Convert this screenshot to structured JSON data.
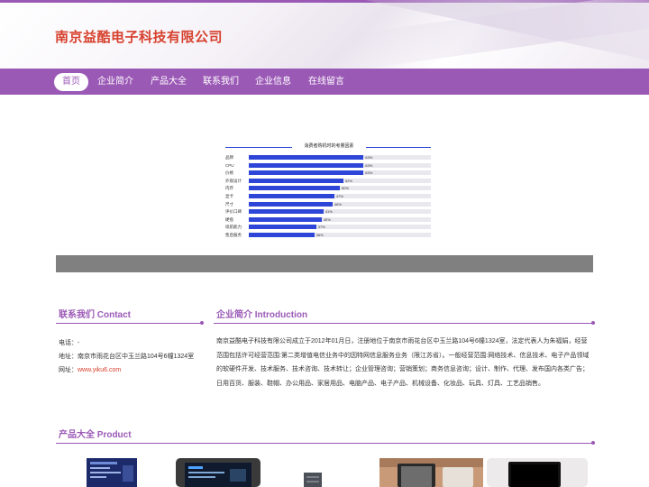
{
  "header": {
    "title": "南京益酷电子科技有限公司"
  },
  "nav": {
    "items": [
      "首页",
      "企业简介",
      "产品大全",
      "联系我们",
      "企业信息",
      "在线留言"
    ],
    "active_index": 0
  },
  "banner_chart": {
    "title": "消费者购机时的考量因素",
    "chart_data": {
      "type": "bar",
      "categories": [
        "品牌",
        "CPU",
        "价格",
        "外观设计",
        "内存",
        "显卡",
        "尺寸",
        "评价口碑",
        "硬盘",
        "续航能力",
        "售后服务"
      ],
      "values": [
        63,
        63,
        63,
        52,
        50,
        47,
        46,
        41,
        40,
        37,
        36
      ],
      "value_labels": [
        "63%",
        "63%",
        "63%",
        "52%",
        "50%",
        "47%",
        "46%",
        "41%",
        "40%",
        "37%",
        "36%"
      ],
      "xlim": [
        0,
        100
      ],
      "orientation": "horizontal",
      "bar_color": "#2d46d8"
    }
  },
  "contact": {
    "title": "联系我们 Contact",
    "phone_label": "电话：-",
    "address_label": "地址：南京市雨花台区中玉兰路104号6幢1324室",
    "website_label": "网址：",
    "website_link": "www.yiku6.com"
  },
  "intro": {
    "title": "企业简介 Introduction",
    "text": "南京益酷电子科技有限公司成立于2012年01月日，注册地位于南京市雨花台区中玉兰路104号6幢1324室，法定代表人为朱福娟，经营范围包括许可经营范围:第二类增值电信业务中的因特网信息服务业务（限江苏省）。一般经营范围:网络技术、信息技术、电子产品领域的软硬件开发、技术服务、技术咨询、技术转让；企业管理咨询；营销策划；商务信息咨询；设计、制作、代理、发布国内各类广告；日用百货、服装、鞋帽、办公用品、家居用品、电脑产品、电子产品、机械设备、化妆品、玩具、灯具、工艺品销售。"
  },
  "products": {
    "title": "产品大全 Product"
  },
  "colors": {
    "accent": "#9b59b6",
    "title_red": "#d7412e",
    "bar_blue": "#2d46d8"
  }
}
